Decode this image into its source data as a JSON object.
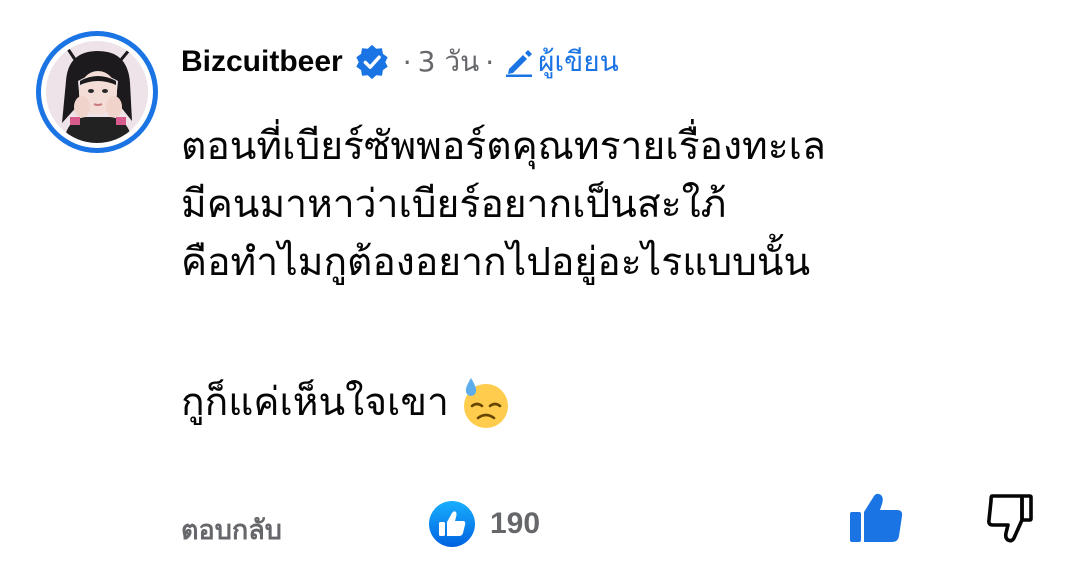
{
  "comment": {
    "author": "Bizcuitbeer",
    "verified_icon": "verified-badge-icon",
    "separator": "·",
    "time": "3 วัน",
    "author_tag_icon": "pencil-icon",
    "author_tag": "ผู้เขียน",
    "lines": [
      "ตอนที่เบียร์ซัพพอร์ตคุณทรายเรื่องทะเล",
      "มีคนมาหาว่าเบียร์อยากเป็นสะใภ้",
      "คือทำไมกูต้องอยากไปอยู่อะไรแบบนั้น",
      "กูก็แค่เห็นใจเขา"
    ],
    "emoji": "downcast-face-with-sweat-emoji",
    "reply_label": "ตอบกลับ",
    "like_count": "190"
  },
  "colors": {
    "accent": "#1b74e4",
    "muted": "#65676b",
    "text": "#050505"
  }
}
